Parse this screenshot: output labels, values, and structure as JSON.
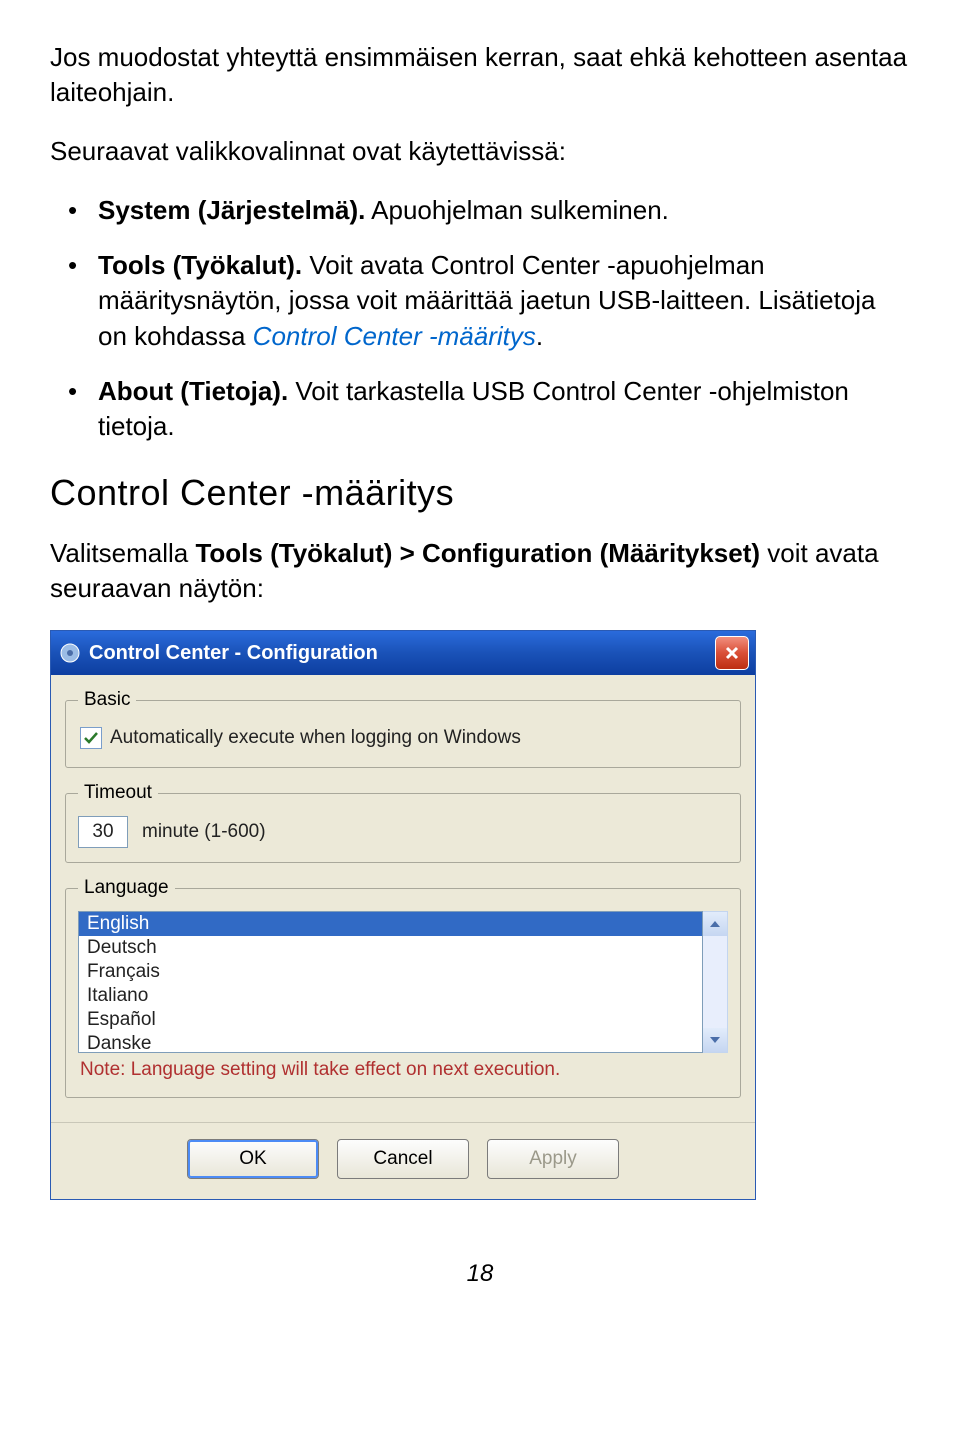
{
  "intro1": "Jos muodostat yhteyttä ensimmäisen kerran, saat ehkä kehotteen asentaa laiteohjain.",
  "intro2": "Seuraavat valikkovalinnat ovat käytettävissä:",
  "bullets": {
    "b1_bold": "System (Järjestelmä).",
    "b1_rest": " Apuohjelman sulkeminen.",
    "b2_bold": "Tools (Työkalut).",
    "b2_rest": " Voit avata Control Center -apuohjelman määritysnäytön, jossa voit määrittää jaetun USB-laitteen. Lisätietoja on kohdassa ",
    "b2_link": "Control Center -määritys",
    "b2_end": ".",
    "b3_bold": "About (Tietoja).",
    "b3_rest": " Voit tarkastella USB Control Center -ohjelmiston tietoja."
  },
  "heading": "Control Center -määritys",
  "para_after_heading_pre": "Valitsemalla ",
  "para_after_heading_bold": "Tools (Työkalut) > Configuration (Määritykset)",
  "para_after_heading_post": " voit avata seuraavan näytön:",
  "dialog": {
    "title": "Control Center - Configuration",
    "basic_legend": "Basic",
    "auto_exec_label": "Automatically execute when logging on Windows",
    "timeout_legend": "Timeout",
    "timeout_value": "30",
    "timeout_unit": "minute (1-600)",
    "language_legend": "Language",
    "languages": [
      "English",
      "Deutsch",
      "Français",
      "Italiano",
      "Español",
      "Danske"
    ],
    "note": "Note: Language setting will take effect on next execution.",
    "ok": "OK",
    "cancel": "Cancel",
    "apply": "Apply"
  },
  "pagenum": "18"
}
